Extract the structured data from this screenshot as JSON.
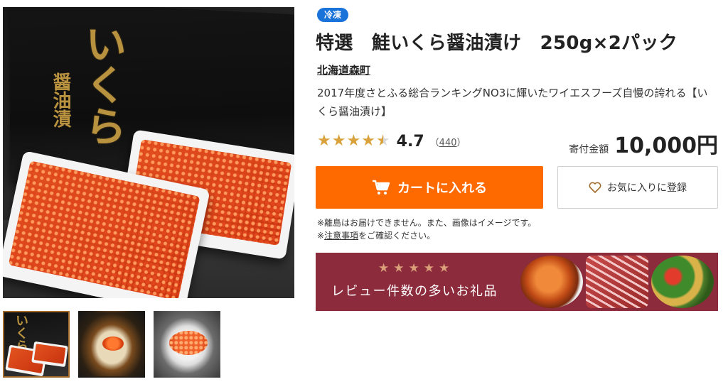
{
  "gallery": {
    "main_image": {
      "alt": "いくら醤油漬",
      "box_calligraphy": "いくら",
      "box_calligraphy_sub": "醤油漬"
    },
    "thumbnails": [
      {
        "name": "thumbnail-box",
        "active": true,
        "calligraphy": "いくら"
      },
      {
        "name": "thumbnail-bowl",
        "active": false
      },
      {
        "name": "thumbnail-plate",
        "active": false
      }
    ]
  },
  "product": {
    "storage_tag": "冷凍",
    "title": "特選　鮭いくら醤油漬け　250g×2パック",
    "municipality": "北海道森町",
    "description": "2017年度さとふる総合ランキングNO3に輝いたワイエスフーズ自慢の誇れる【いくら醤油漬け】",
    "rating": {
      "stars": 4.5,
      "value": "4.7",
      "review_count_open": "（",
      "review_count": "440",
      "review_count_close": "）"
    },
    "price": {
      "label": "寄付金額",
      "value": "10,000円"
    }
  },
  "actions": {
    "cart_label": "カートに入れる",
    "favorite_label": "お気に入りに登録"
  },
  "notes": {
    "line1": "※離島はお届けできません。また、画像はイメージです。",
    "line2_prefix": "※",
    "line2_link": "注意事項",
    "line2_suffix": "をご確認ください。"
  },
  "banner": {
    "stars": "★★★★★",
    "text": "レビュー件数の多いお礼品"
  },
  "colors": {
    "tag_blue": "#1a73d9",
    "cart_orange": "#ff6a00",
    "star_gold": "#d9a23a",
    "banner_red": "#8c2b3b"
  }
}
